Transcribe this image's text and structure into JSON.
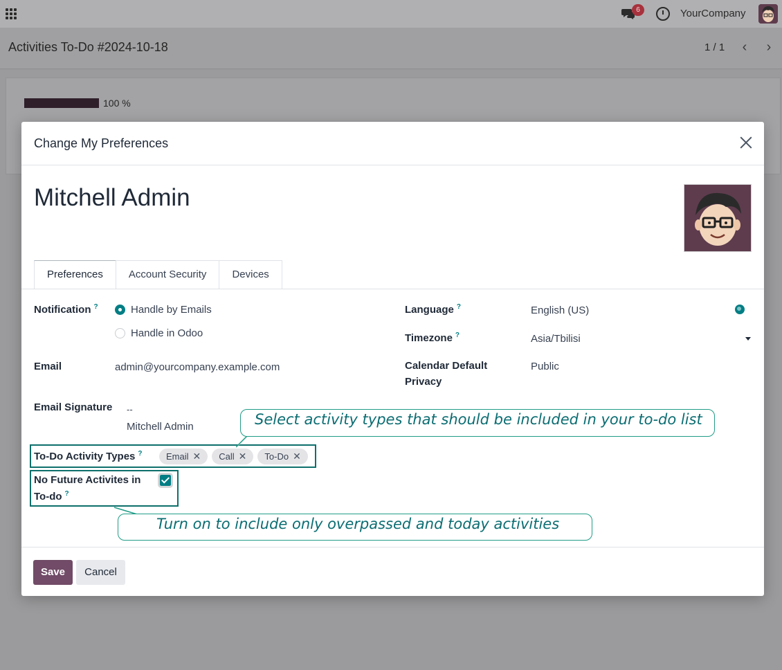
{
  "topbar": {
    "messages_count": "6",
    "company": "YourCompany"
  },
  "subheader": {
    "record_title": "Activities To-Do #2024-10-18",
    "pager": "1 / 1"
  },
  "background_card": {
    "progress_percent": 100,
    "progress_label": "100 %"
  },
  "modal": {
    "title": "Change My Preferences",
    "user_name": "Mitchell Admin",
    "tabs": [
      {
        "label": "Preferences",
        "active": true
      },
      {
        "label": "Account Security",
        "active": false
      },
      {
        "label": "Devices",
        "active": false
      }
    ],
    "fields": {
      "notification": {
        "label": "Notification",
        "help": "?",
        "options": [
          "Handle by Emails",
          "Handle in Odoo"
        ],
        "selected": "Handle by Emails"
      },
      "email": {
        "label": "Email",
        "value": "admin@yourcompany.example.com"
      },
      "email_signature": {
        "label": "Email Signature",
        "line1": "--",
        "line2": "Mitchell Admin"
      },
      "language": {
        "label": "Language",
        "help": "?",
        "value": "English (US)"
      },
      "timezone": {
        "label": "Timezone",
        "help": "?",
        "value": "Asia/Tbilisi"
      },
      "calendar_privacy": {
        "label_line1": "Calendar Default",
        "label_line2": "Privacy",
        "value": "Public"
      },
      "todo_activity_types": {
        "label": "To-Do Activity Types",
        "help": "?",
        "tags": [
          "Email",
          "Call",
          "To-Do"
        ]
      },
      "no_future_activities": {
        "label_line1": "No Future Activites in",
        "label_line2": "To-do",
        "help": "?",
        "checked": true
      }
    },
    "callouts": {
      "activity_types": "Select activity types that should be included in your to-do list",
      "no_future": "Turn on to include only overpassed and today activities"
    },
    "buttons": {
      "save": "Save",
      "cancel": "Cancel"
    }
  },
  "colors": {
    "brand": "#714b67",
    "accent": "#017e84",
    "callout_border": "#1f9c86",
    "callout_text": "#0b6d72",
    "badge": "#a7323d"
  }
}
